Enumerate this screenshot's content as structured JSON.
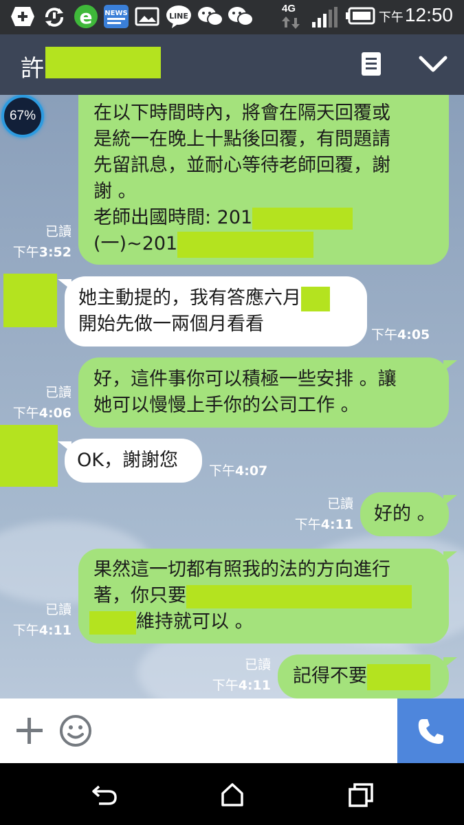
{
  "status_bar": {
    "time_prefix": "下午",
    "time": "12:50",
    "network": "4G",
    "icons": [
      "add-icon",
      "sync-icon",
      "browser-icon",
      "news-icon",
      "gallery-icon",
      "line-icon",
      "wechat-icon",
      "wechat-icon",
      "signal-icon",
      "battery-icon"
    ],
    "news_label": "NEWS",
    "line_label": "LINE"
  },
  "header": {
    "contact_name": "許"
  },
  "overlay": {
    "battery_percent": "67%"
  },
  "messages": [
    {
      "direction": "out",
      "lines": [
        "在以下時間時內，將會在隔天回覆或",
        "是統一在晚上十點後回覆，有問題請",
        "先留訊息，並耐心等待老師回覆，謝",
        "謝 。",
        "老師出國時間: 201",
        "(一)~201"
      ],
      "read": "已讀",
      "time_prefix": "下午",
      "time": "3:52"
    },
    {
      "direction": "in",
      "lines": [
        "她主動提的，我有答應六月",
        "開始先做一兩個月看看"
      ],
      "time_prefix": "下午",
      "time": "4:05"
    },
    {
      "direction": "out",
      "lines": [
        "好，這件事你可以積極一些安排 。讓",
        "她可以慢慢上手你的公司工作 。"
      ],
      "read": "已讀",
      "time_prefix": "下午",
      "time": "4:06"
    },
    {
      "direction": "in",
      "lines": [
        "OK，謝謝您"
      ],
      "time_prefix": "下午",
      "time": "4:07"
    },
    {
      "direction": "out",
      "lines": [
        "好的 。"
      ],
      "read": "已讀",
      "time_prefix": "下午",
      "time": "4:11"
    },
    {
      "direction": "out",
      "lines": [
        "果然這一切都有照我的法的方向進行",
        "著，你只要",
        "維持就可以 。"
      ],
      "read": "已讀",
      "time_prefix": "下午",
      "time": "4:11"
    },
    {
      "direction": "out",
      "lines": [
        "記得不要"
      ],
      "read": "已讀",
      "time_prefix": "下午",
      "time": "4:11"
    }
  ],
  "input_bar": {
    "icons": [
      "plus-icon",
      "emoji-icon",
      "phone-icon"
    ]
  },
  "nav_bar": {
    "icons": [
      "back-icon",
      "home-icon",
      "recents-icon"
    ]
  },
  "colors": {
    "header": "#3c4557",
    "bubble_out": "#a4e27c",
    "bubble_in": "#ffffff",
    "redaction": "#b4e31f",
    "call_button": "#4e86dc"
  }
}
